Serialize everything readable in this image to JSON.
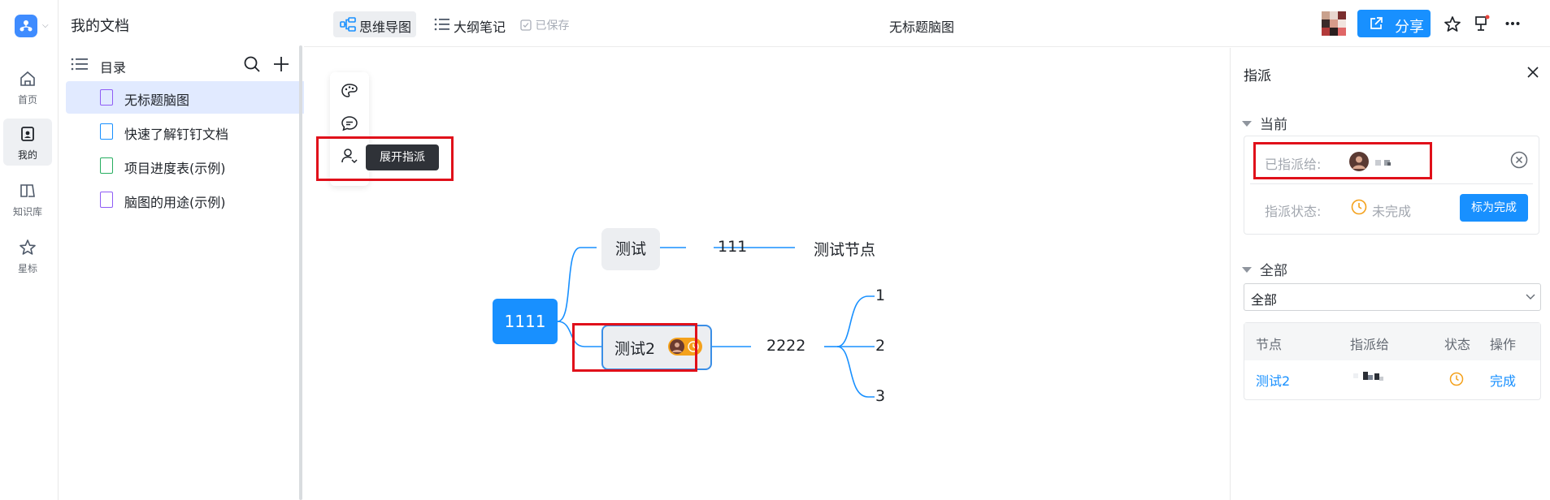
{
  "rail": {
    "items": [
      {
        "label": "首页",
        "icon": "home-icon"
      },
      {
        "label": "我的",
        "icon": "my-docs-icon"
      },
      {
        "label": "知识库",
        "icon": "knowledge-base-icon"
      },
      {
        "label": "星标",
        "icon": "star-icon"
      }
    ]
  },
  "sidebar": {
    "title": "我的文档",
    "toc_label": "目录",
    "files": [
      {
        "label": "无标题脑图",
        "icon": "mindmap-file-icon",
        "color": "#8f5cf5"
      },
      {
        "label": "快速了解钉钉文档",
        "icon": "doc-file-icon",
        "color": "#1890ff"
      },
      {
        "label": "项目进度表(示例)",
        "icon": "sheet-file-icon",
        "color": "#27ae60"
      },
      {
        "label": "脑图的用途(示例)",
        "icon": "mindmap-file-icon",
        "color": "#8f5cf5"
      }
    ]
  },
  "topbar": {
    "tab_mindmap": "思维导图",
    "tab_outline": "大纲笔记",
    "saved": "已保存",
    "doc_title": "无标题脑图",
    "share": "分享"
  },
  "canvas": {
    "tooltip": "展开指派",
    "nodes": {
      "root": "1111",
      "test": "测试",
      "n111": "111",
      "test_node": "测试节点",
      "test2": "测试2",
      "n2222": "2222",
      "c1": "1",
      "c2": "2",
      "c3": "3"
    }
  },
  "assign_panel": {
    "title": "指派",
    "current_section": "当前",
    "assigned_to_label": "已指派给:",
    "status_label": "指派状态:",
    "status_value": "未完成",
    "mark_done": "标为完成",
    "all_section": "全部",
    "filter_value": "全部",
    "table": {
      "headers": [
        "节点",
        "指派给",
        "状态",
        "操作"
      ],
      "rows": [
        {
          "node": "测试2",
          "action": "完成"
        }
      ]
    }
  },
  "colors": {
    "accent": "#1890ff",
    "highlight_box": "#e0101a",
    "pending": "#f4a11b",
    "mindmap_line": "#1890ff"
  }
}
